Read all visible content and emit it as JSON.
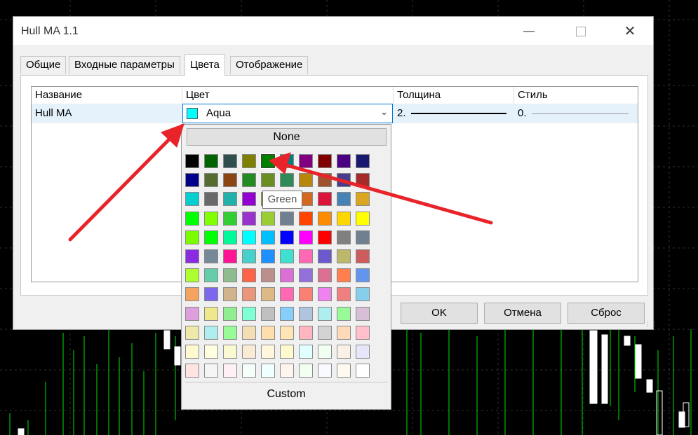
{
  "window": {
    "title": "Hull MA 1.1"
  },
  "tabs": [
    {
      "label": "Общие"
    },
    {
      "label": "Входные параметры"
    },
    {
      "label": "Цвета"
    },
    {
      "label": "Отображение"
    }
  ],
  "grid": {
    "headers": [
      "Название",
      "Цвет",
      "Толщина",
      "Стиль"
    ],
    "row": {
      "name": "Hull MA",
      "color": "Aqua",
      "color_hex": "#00ffff",
      "width": "2.",
      "style": "0."
    }
  },
  "buttons": {
    "ok": "OK",
    "cancel": "Отмена",
    "reset": "Сброс"
  },
  "color_picker": {
    "none_label": "None",
    "custom_label": "Custom",
    "tooltip": "Green",
    "palette": [
      [
        "#000000",
        "#006400",
        "#2f4f4f",
        "#808000",
        "#008000",
        "#008080",
        "#800080",
        "#800000",
        "#4b0082",
        "#191970"
      ],
      [
        "#00008b",
        "#556b2f",
        "#8b4513",
        "#228b22",
        "#6b8e23",
        "#2e8b57",
        "#b8860b",
        "#a0522d",
        "#483d8b",
        "#a52a2a"
      ],
      [
        "#00ced1",
        "#696969",
        "#20b2aa",
        "#9400d3",
        "#808000",
        "#008b8b",
        "#d2691e",
        "#dc143c",
        "#4682b4",
        "#daa520"
      ],
      [
        "#00ff00",
        "#7fff00",
        "#32cd32",
        "#9932cc",
        "#9acd32",
        "#708090",
        "#ff4500",
        "#ff8c00",
        "#ffd700",
        "#ffff00"
      ],
      [
        "#7cfc00",
        "#00ff00",
        "#00fa9a",
        "#00ffff",
        "#00bfff",
        "#0000ff",
        "#ff00ff",
        "#ff0000",
        "#808080",
        "#708090"
      ],
      [
        "#8a2be2",
        "#778899",
        "#ff1493",
        "#48d1cc",
        "#1e90ff",
        "#40e0d0",
        "#ff69b4",
        "#6a5acd",
        "#bdb76b",
        "#cd5c5c"
      ],
      [
        "#adff2f",
        "#66cdaa",
        "#8fbc8f",
        "#ff6347",
        "#bc8f8f",
        "#da70d6",
        "#9370db",
        "#db7093",
        "#ff7f50",
        "#6495ed",
        "#a9a9a9"
      ],
      [
        "#f4a460",
        "#7b68ee",
        "#d2b48c",
        "#e9967a",
        "#deb887",
        "#ff69b4",
        "#fa8072",
        "#ee82ee",
        "#f08080",
        "#87ceeb",
        "#ffa07a"
      ],
      [
        "#dda0dd",
        "#f0e68c",
        "#90ee90",
        "#7fffd4",
        "#c0c0c0",
        "#87cefa",
        "#b0c4de",
        "#afeeee",
        "#98fb98",
        "#d8bfd8",
        "#b0e0e6"
      ],
      [
        "#eee8aa",
        "#afeeee",
        "#98fb98",
        "#f5deb3",
        "#ffdead",
        "#ffe4b5",
        "#ffb6c1",
        "#d3d3d3",
        "#ffdab9",
        "#ffc0cb",
        "#ffe4c4"
      ],
      [
        "#fffacd",
        "#ffffe0",
        "#fafad2",
        "#faebd7",
        "#fff8dc",
        "#fffacd",
        "#e0ffff",
        "#f0fff0",
        "#faf0e6",
        "#e6e6fa"
      ],
      [
        "#ffe4e1",
        "#f5f5f5",
        "#fff0f5",
        "#f5fffa",
        "#f0ffff",
        "#fff5ee",
        "#f0fff0",
        "#f8f8ff",
        "#fffaf0",
        "#ffffff"
      ]
    ]
  }
}
